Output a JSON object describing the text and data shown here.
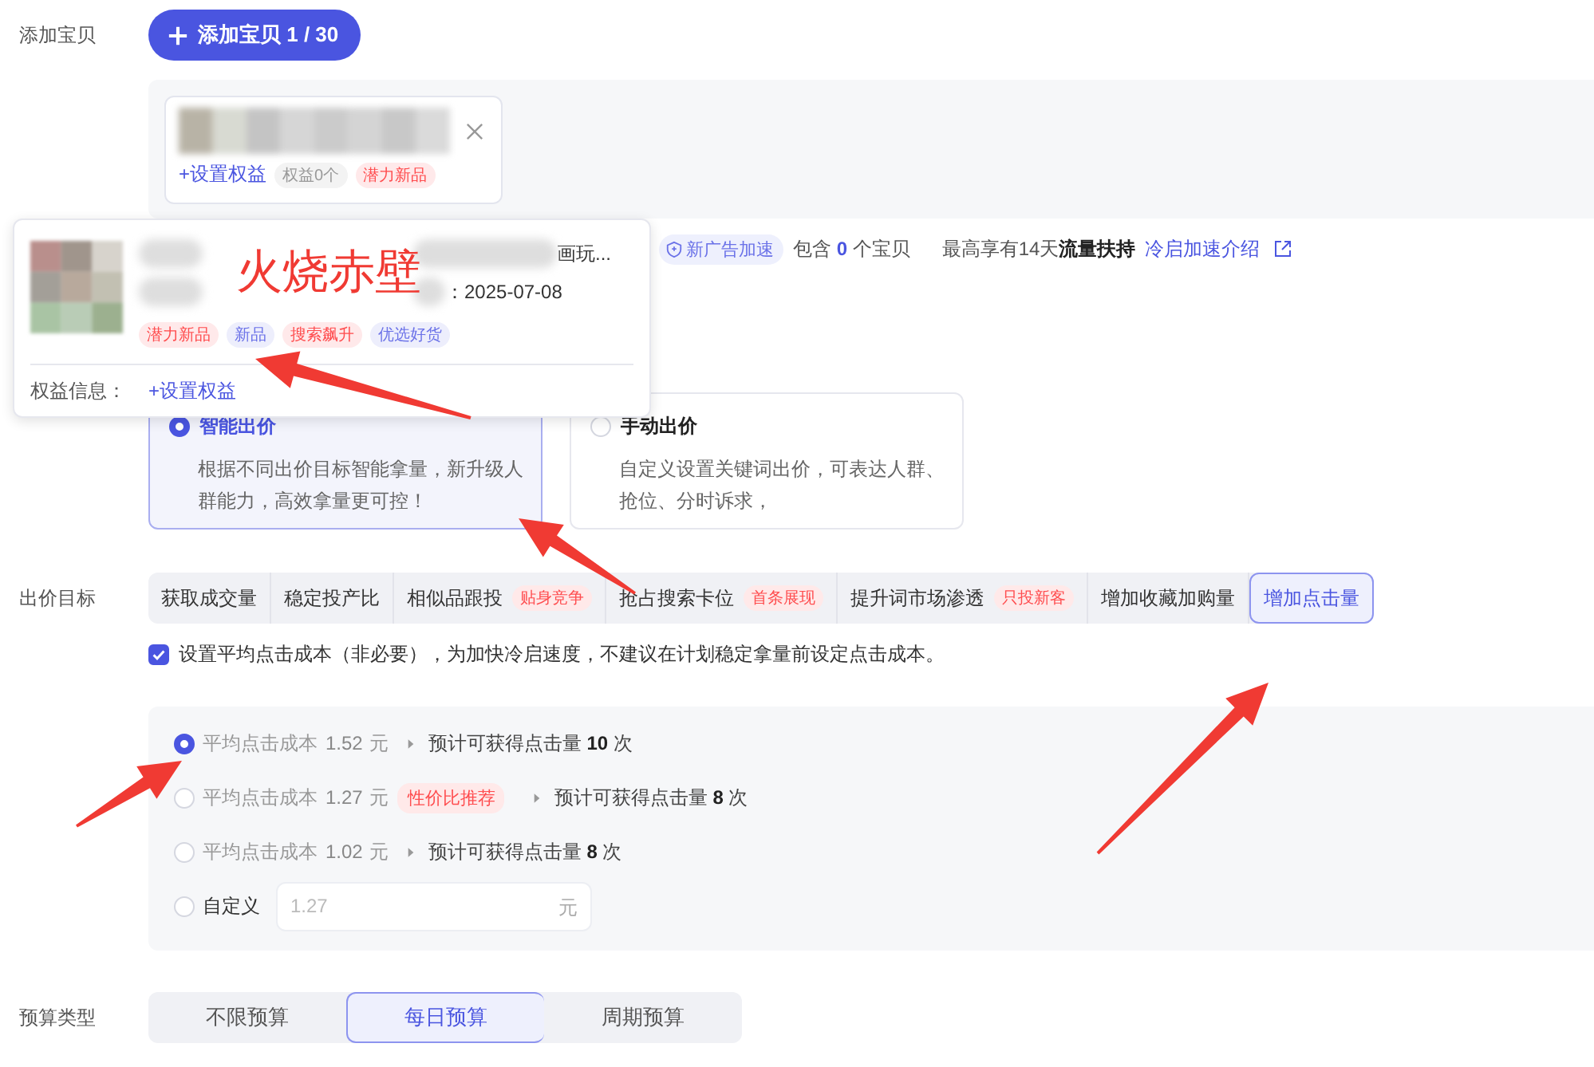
{
  "add_item": {
    "label": "添加宝贝",
    "button": "添加宝贝 1 / 30",
    "items": [
      {
        "kind": "picture",
        "link": "+设置权益",
        "tags": [
          {
            "text": "权益0个",
            "color": "#999999"
          },
          {
            "text": "潜力新品",
            "color": "#ff4d4f"
          }
        ]
      }
    ]
  },
  "popup": {
    "title_tail": "画玩...",
    "date": "：2025-07-08",
    "tags": [
      {
        "text": "潜力新品",
        "color": "#ff4d4f"
      },
      {
        "text": "新品",
        "color": "#6b72e8"
      },
      {
        "text": "搜索飙升",
        "color": "#ff4d4f"
      },
      {
        "text": "优选好货",
        "color": "#6b72e8"
      }
    ],
    "rights_label": "权益信息：",
    "rights_link": "+设置权益"
  },
  "item_summary": {
    "badge": "新广告加速",
    "count_text": "包含 **0** 个宝贝",
    "support_text": "最高享有14天**流量扶持**",
    "link": "冷启加速介绍"
  },
  "bid_methods": [
    {
      "title": "智能出价",
      "desc": "根据不同出价目标智能拿量，新升级人群能力，高效拿量更可控！",
      "selected": true
    },
    {
      "title": "手动出价",
      "desc": "自定义设置关键词出价，可表达人群、抢位、分时诉求，",
      "selected": false
    }
  ],
  "bid_target": {
    "label": "出价目标",
    "options": [
      {
        "label": "获取成交量",
        "selected": false
      },
      {
        "label": "稳定投产比",
        "selected": false
      },
      {
        "label": "相似品跟投",
        "tag": "贴身竞争",
        "selected": false
      },
      {
        "label": "抢占搜索卡位",
        "tag": "首条展现",
        "selected": false
      },
      {
        "label": "提升词市场渗透",
        "tag": "只投新客",
        "selected": false
      },
      {
        "label": "增加收藏加购量",
        "selected": false
      },
      {
        "label": "增加点击量",
        "selected": true
      }
    ]
  },
  "avg_cost_checkbox": {
    "checked": true,
    "text": "设置平均点击成本（非必要），为加快冷启速度，不建议在计划稳定拿量前设定点击成本。"
  },
  "cost_options": [
    {
      "kind": "preset",
      "label": "平均点击成本",
      "price": "1.52",
      "unit": "元",
      "estimate": "预计可获得点击量 **10** 次",
      "selected": true
    },
    {
      "kind": "preset",
      "label": "平均点击成本",
      "price": "1.27",
      "unit": "元",
      "tag": "性价比推荐",
      "estimate": "预计可获得点击量 **8** 次",
      "selected": false
    },
    {
      "kind": "preset",
      "label": "平均点击成本",
      "price": "1.02",
      "unit": "元",
      "estimate": "预计可获得点击量 **8** 次",
      "selected": false
    },
    {
      "kind": "custom",
      "label": "自定义",
      "placeholder": "1.27",
      "unit": "元",
      "selected": false
    }
  ],
  "budget": {
    "label": "预算类型",
    "options": [
      {
        "label": "不限预算",
        "selected": false
      },
      {
        "label": "每日预算",
        "selected": true
      },
      {
        "label": "周期预算",
        "selected": false
      }
    ]
  },
  "annotation": {
    "caption": "火烧赤壁"
  }
}
